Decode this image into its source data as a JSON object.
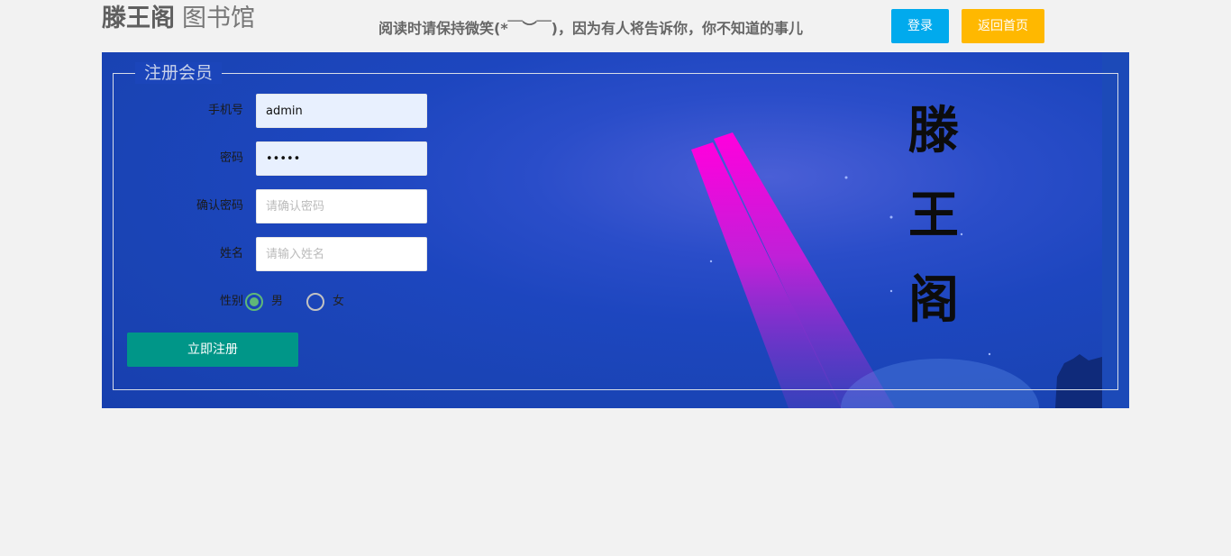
{
  "header": {
    "brand_main": "滕王阁",
    "brand_sub": "图书馆",
    "slogan": "阅读时请保持微笑(*￣︶￣)，因为有人将告诉你，你不知道的事儿",
    "login_label": "登录",
    "home_label": "返回首页"
  },
  "form": {
    "legend": "注册会员",
    "phone": {
      "label": "手机号",
      "value": "admin"
    },
    "password": {
      "label": "密码",
      "value": "•••••"
    },
    "confirm": {
      "label": "确认密码",
      "placeholder": "请确认密码"
    },
    "name": {
      "label": "姓名",
      "placeholder": "请输入姓名"
    },
    "gender": {
      "label": "性别",
      "options": [
        "男",
        "女"
      ],
      "selected": "男"
    },
    "submit_label": "立即注册"
  },
  "banner": {
    "chars": [
      "滕",
      "王",
      "阁"
    ]
  },
  "colors": {
    "login_btn": "#01AAED",
    "home_btn": "#FFB800",
    "submit_btn": "#009688",
    "radio_checked": "#5FB878",
    "banner_bg": "#1a44b5",
    "page_bg": "#f2f2f2"
  }
}
